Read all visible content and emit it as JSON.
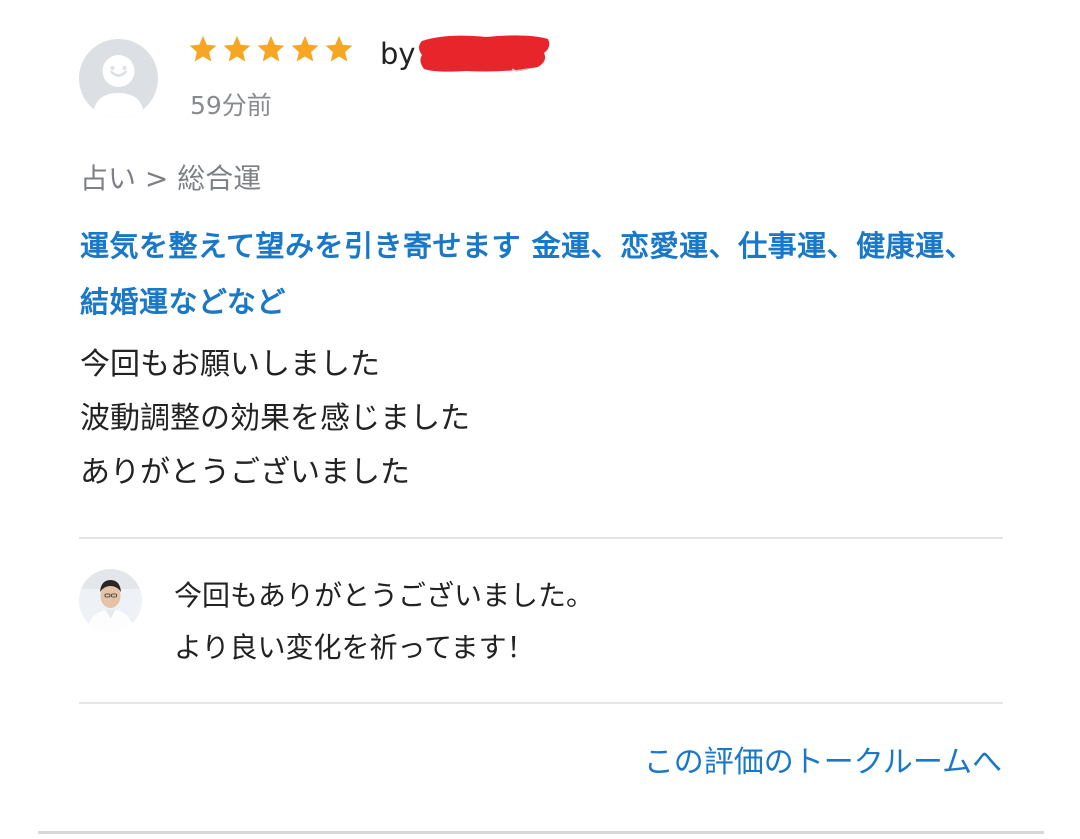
{
  "review": {
    "rating": 5,
    "rating_max": 5,
    "by_label": "by",
    "reviewer_name": "",
    "time_ago": "59分前",
    "category": "占い > 総合運",
    "service_title": "運気を整えて望みを引き寄せます 金運、恋愛運、仕事運、健康運、結婚運などなど",
    "body_lines": [
      "今回もお願いしました",
      "波動調整の効果を感じました",
      "ありがとうございました"
    ]
  },
  "reply": {
    "lines": [
      "今回もありがとうございました。",
      "より良い変化を祈ってます！"
    ]
  },
  "talkroom_link": "この評価のトークルームへ",
  "icons": {
    "star": "star-icon",
    "reviewer_avatar": "default-user-avatar",
    "seller_avatar": "seller-photo-avatar"
  },
  "colors": {
    "star": "#f5a623",
    "accent_blue": "#1a78c8",
    "redaction": "#e8252b",
    "muted_text": "#888b90"
  }
}
